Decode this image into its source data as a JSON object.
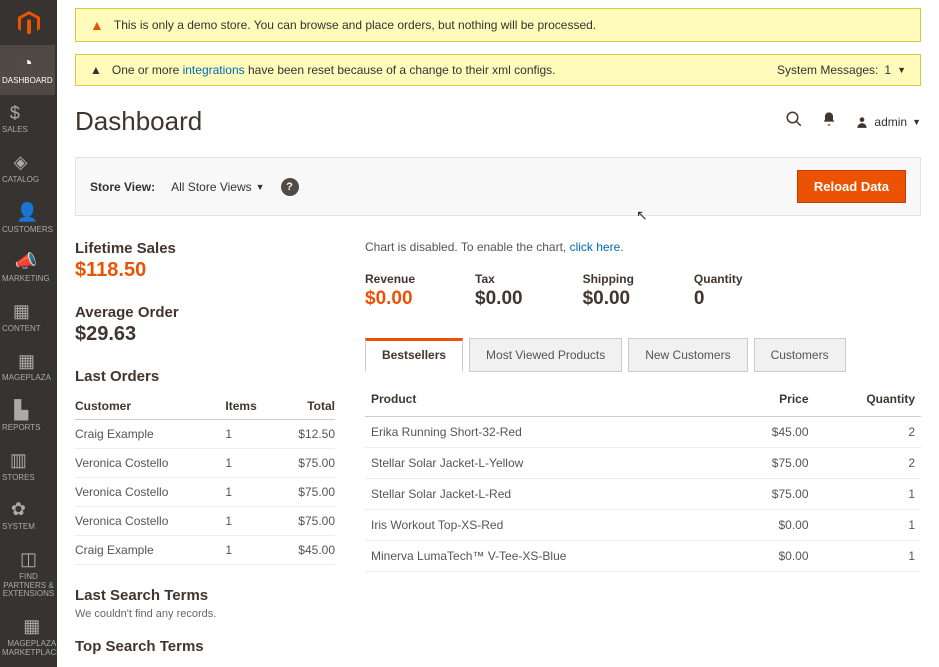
{
  "sidebar": {
    "items": [
      {
        "label": "DASHBOARD",
        "name": "sidebar-item-dashboard",
        "icon": "◔",
        "active": true
      },
      {
        "label": "SALES",
        "name": "sidebar-item-sales",
        "icon": "$"
      },
      {
        "label": "CATALOG",
        "name": "sidebar-item-catalog",
        "icon": "◈"
      },
      {
        "label": "CUSTOMERS",
        "name": "sidebar-item-customers",
        "icon": "👤"
      },
      {
        "label": "MARKETING",
        "name": "sidebar-item-marketing",
        "icon": "📣"
      },
      {
        "label": "CONTENT",
        "name": "sidebar-item-content",
        "icon": "▦"
      },
      {
        "label": "MAGEPLAZA",
        "name": "sidebar-item-mageplaza",
        "icon": "▦"
      },
      {
        "label": "REPORTS",
        "name": "sidebar-item-reports",
        "icon": "▙"
      },
      {
        "label": "STORES",
        "name": "sidebar-item-stores",
        "icon": "▥"
      },
      {
        "label": "SYSTEM",
        "name": "sidebar-item-system",
        "icon": "✿"
      },
      {
        "label": "FIND PARTNERS & EXTENSIONS",
        "name": "sidebar-item-partners",
        "icon": "◫"
      },
      {
        "label": "MAGEPLAZA MARKETPLACE",
        "name": "sidebar-item-marketplace",
        "icon": "▦"
      }
    ]
  },
  "banner_demo": "This is only a demo store. You can browse and place orders, but nothing will be processed.",
  "banner_integrations_pre": "One or more ",
  "banner_integrations_link": "integrations",
  "banner_integrations_post": " have been reset because of a change to their xml configs.",
  "system_messages_label": "System Messages:",
  "system_messages_count": "1",
  "page_title": "Dashboard",
  "admin_label": "admin",
  "store_view_label": "Store View:",
  "store_view_value": "All Store Views",
  "reload_label": "Reload Data",
  "lifetime_sales": {
    "label": "Lifetime Sales",
    "value": "$118.50"
  },
  "avg_order": {
    "label": "Average Order",
    "value": "$29.63"
  },
  "last_orders": {
    "title": "Last Orders",
    "headers": [
      "Customer",
      "Items",
      "Total"
    ],
    "rows": [
      {
        "customer": "Craig Example",
        "items": "1",
        "total": "$12.50"
      },
      {
        "customer": "Veronica Costello",
        "items": "1",
        "total": "$75.00"
      },
      {
        "customer": "Veronica Costello",
        "items": "1",
        "total": "$75.00"
      },
      {
        "customer": "Veronica Costello",
        "items": "1",
        "total": "$75.00"
      },
      {
        "customer": "Craig Example",
        "items": "1",
        "total": "$45.00"
      }
    ]
  },
  "last_search": {
    "title": "Last Search Terms",
    "empty": "We couldn't find any records."
  },
  "top_search": {
    "title": "Top Search Terms"
  },
  "chart_disabled_pre": "Chart is disabled. To enable the chart, ",
  "chart_disabled_link": "click here",
  "metrics": [
    {
      "label": "Revenue",
      "value": "$0.00",
      "orange": true
    },
    {
      "label": "Tax",
      "value": "$0.00"
    },
    {
      "label": "Shipping",
      "value": "$0.00"
    },
    {
      "label": "Quantity",
      "value": "0"
    }
  ],
  "tabs": [
    {
      "label": "Bestsellers",
      "active": true
    },
    {
      "label": "Most Viewed Products"
    },
    {
      "label": "New Customers"
    },
    {
      "label": "Customers"
    }
  ],
  "bestsellers": {
    "headers": [
      "Product",
      "Price",
      "Quantity"
    ],
    "rows": [
      {
        "product": "Erika Running Short-32-Red",
        "price": "$45.00",
        "qty": "2"
      },
      {
        "product": "Stellar Solar Jacket-L-Yellow",
        "price": "$75.00",
        "qty": "2"
      },
      {
        "product": "Stellar Solar Jacket-L-Red",
        "price": "$75.00",
        "qty": "1"
      },
      {
        "product": "Iris Workout Top-XS-Red",
        "price": "$0.00",
        "qty": "1"
      },
      {
        "product": "Minerva LumaTech™ V-Tee-XS-Blue",
        "price": "$0.00",
        "qty": "1"
      }
    ]
  }
}
